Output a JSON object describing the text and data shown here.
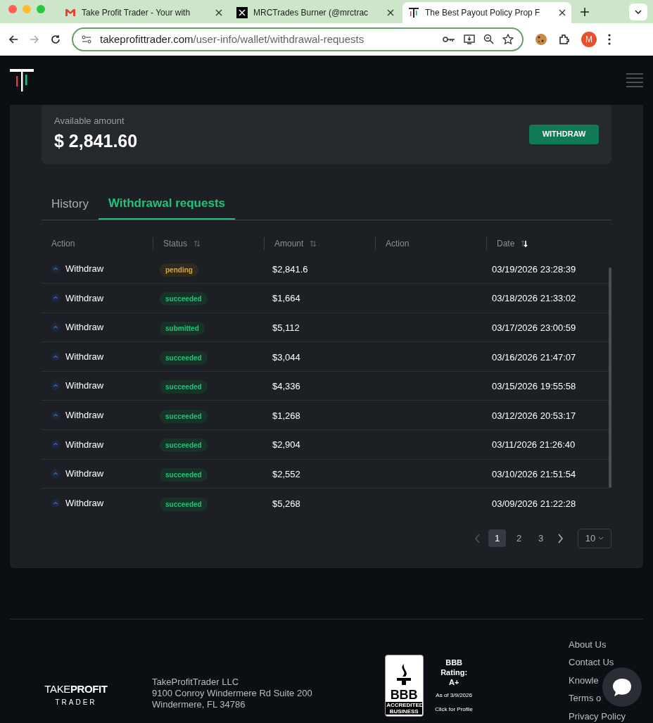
{
  "browser": {
    "tabs": [
      {
        "title": "Take Profit Trader - Your with",
        "selected": false,
        "kind": "mail"
      },
      {
        "title": "MRCTrades Burner (@mrctrac",
        "selected": false,
        "kind": "x"
      },
      {
        "title": "The Best Payout Policy Prop F",
        "selected": true,
        "kind": "site"
      }
    ],
    "url_host": "takeprofittrader.com",
    "url_path": "/user-info/wallet/withdrawal-requests",
    "profile_initial": "M"
  },
  "balance": {
    "label": "Available amount",
    "amount": "$ 2,841.60",
    "button": "WITHDRAW"
  },
  "tabs": [
    {
      "label": "History",
      "selected": false
    },
    {
      "label": "Withdrawal requests",
      "selected": true
    }
  ],
  "table": {
    "columns": [
      {
        "label": "Action",
        "kind": "plain"
      },
      {
        "label": "Status",
        "kind": "sortable"
      },
      {
        "label": "Amount",
        "kind": "sortable"
      },
      {
        "label": "Action",
        "kind": "plain"
      },
      {
        "label": "Date",
        "kind": "sorted"
      }
    ],
    "rows": [
      {
        "action": "Withdraw",
        "status": "pending",
        "color": "#d9a43c",
        "amount": "$2,841.6",
        "date": "03/19/2026 23:28:39"
      },
      {
        "action": "Withdraw",
        "status": "succeeded",
        "color": "#1fc47a",
        "amount": "$1,664",
        "date": "03/18/2026 21:33:02"
      },
      {
        "action": "Withdraw",
        "status": "submitted",
        "color": "#1fc47a",
        "amount": "$5,112",
        "date": "03/17/2026 23:00:59"
      },
      {
        "action": "Withdraw",
        "status": "succeeded",
        "color": "#1fc47a",
        "amount": "$3,044",
        "date": "03/16/2026 21:47:07"
      },
      {
        "action": "Withdraw",
        "status": "succeeded",
        "color": "#1fc47a",
        "amount": "$4,336",
        "date": "03/15/2026 19:55:58"
      },
      {
        "action": "Withdraw",
        "status": "succeeded",
        "color": "#1fc47a",
        "amount": "$1,268",
        "date": "03/12/2026 20:53:17"
      },
      {
        "action": "Withdraw",
        "status": "succeeded",
        "color": "#1fc47a",
        "amount": "$2,904",
        "date": "03/11/2026 21:26:40"
      },
      {
        "action": "Withdraw",
        "status": "succeeded",
        "color": "#1fc47a",
        "amount": "$2,552",
        "date": "03/10/2026 21:51:54"
      },
      {
        "action": "Withdraw",
        "status": "succeeded",
        "color": "#1fc47a",
        "amount": "$5,268",
        "date": "03/09/2026 21:22:28"
      }
    ]
  },
  "pagination": {
    "pages": [
      {
        "label": "1",
        "selected": true
      },
      {
        "label": "2",
        "selected": false
      },
      {
        "label": "3",
        "selected": false
      }
    ],
    "page_size": "10"
  },
  "footer": {
    "logo_top": "TAKE**PROFIT**",
    "logo_bottom": "TRADER",
    "address": [
      "TakeProfitTrader LLC",
      "9100 Conroy Windermere Rd Suite 200",
      "Windermere, FL 34786"
    ],
    "bbb": {
      "seal_top": "BBB",
      "seal_bottom": "ACCREDITED BUSINESS",
      "rating": "BBB Rating: A+",
      "as_of": "As of 3/9/2026",
      "link": "Click for Profile"
    },
    "links": [
      "About Us",
      "Contact Us",
      "Knowle",
      "Terms o",
      "Privacy Policy"
    ]
  }
}
